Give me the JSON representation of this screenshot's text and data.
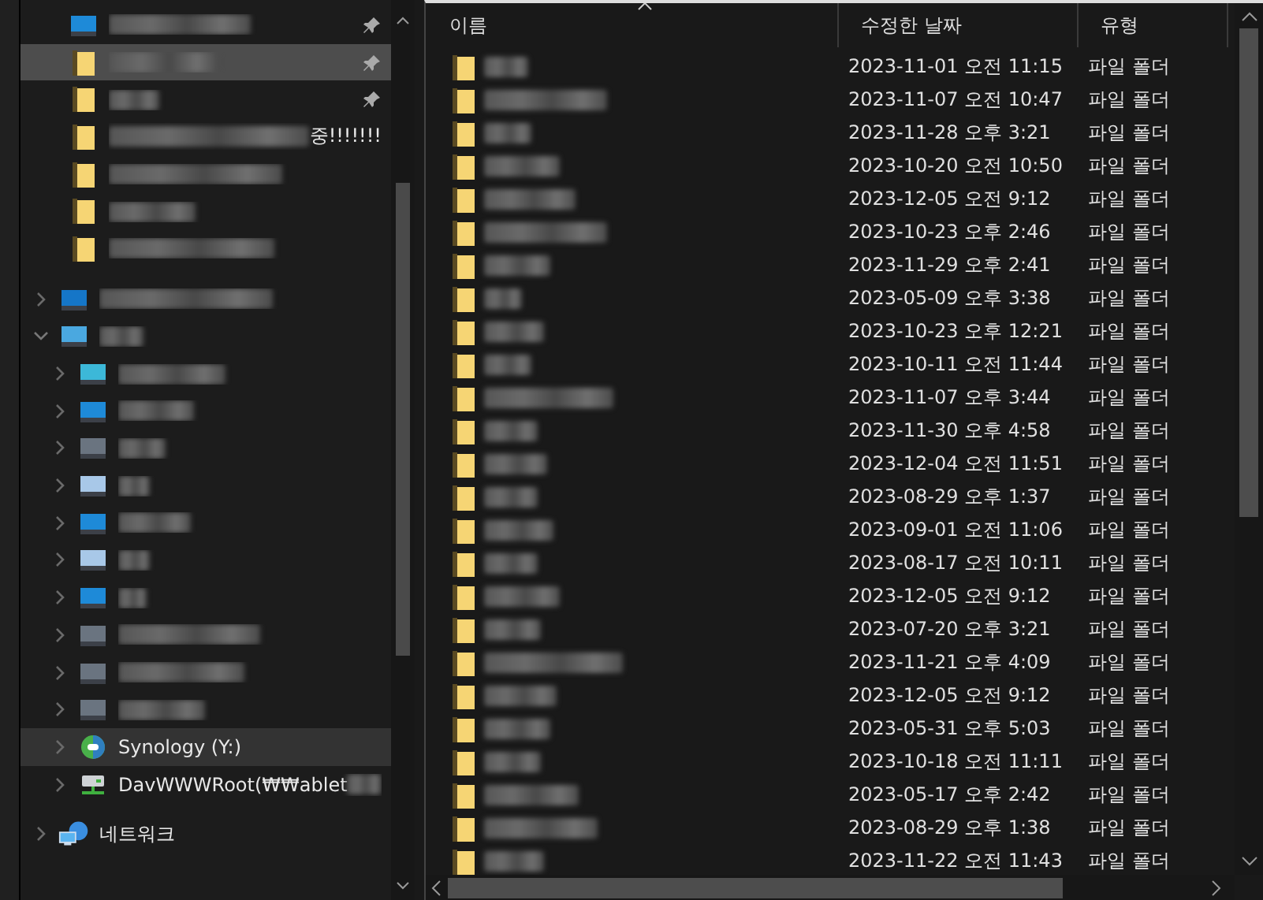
{
  "sidebar": {
    "items": [
      {
        "kind": "blue",
        "blurred": true,
        "pinned": true,
        "selected": false
      },
      {
        "kind": "folder",
        "blurred": true,
        "pinned": true,
        "selected": true
      },
      {
        "kind": "folder",
        "blurred": true,
        "pinned": true,
        "selected": false
      },
      {
        "kind": "folder",
        "blurred": true,
        "label": "중!!!!!!!",
        "pinned": false,
        "selected": false
      },
      {
        "kind": "folder",
        "blurred": true,
        "pinned": false,
        "selected": false
      },
      {
        "kind": "folder",
        "blurred": true,
        "pinned": false,
        "selected": false
      },
      {
        "kind": "folder",
        "blurred": true,
        "pinned": false,
        "selected": false
      },
      {
        "kind": "cloud",
        "blurred": true,
        "expanded": false,
        "selected": false
      },
      {
        "kind": "pc",
        "blurred": true,
        "expanded": true,
        "selected": false,
        "children": [
          {
            "kind": "cyan",
            "blurred": true,
            "expanded": false,
            "selected": false
          },
          {
            "kind": "blue",
            "blurred": true,
            "expanded": false,
            "selected": false
          },
          {
            "kind": "grey",
            "blurred": true,
            "expanded": false,
            "selected": false
          },
          {
            "kind": "light",
            "blurred": true,
            "expanded": false,
            "selected": false
          },
          {
            "kind": "blue",
            "blurred": true,
            "expanded": false,
            "selected": false
          },
          {
            "kind": "light",
            "blurred": true,
            "expanded": false,
            "selected": false
          },
          {
            "kind": "blue",
            "blurred": true,
            "expanded": false,
            "selected": false
          },
          {
            "kind": "grey",
            "blurred": true,
            "expanded": false,
            "selected": false
          },
          {
            "kind": "grey",
            "blurred": true,
            "expanded": false,
            "selected": false
          },
          {
            "kind": "grey",
            "blurred": true,
            "expanded": false,
            "selected": false
          },
          {
            "kind": "nas",
            "blurred": false,
            "label": "Synology (Y:)",
            "expanded": false,
            "selected": true
          },
          {
            "kind": "netdrive",
            "blurred": true,
            "label": "DavWWWRoot(₩₩ablet",
            "expanded": false,
            "selected": false
          }
        ]
      },
      {
        "kind": "network",
        "blurred": false,
        "label": "네트워크",
        "expanded": false,
        "selected": false
      }
    ]
  },
  "table": {
    "columns": [
      "이름",
      "수정한 날짜",
      "유형"
    ],
    "rows": [
      {
        "date": "2023-11-01 오전 11:15",
        "type": "파일 폴더"
      },
      {
        "date": "2023-11-07 오전 10:47",
        "type": "파일 폴더"
      },
      {
        "date": "2023-11-28 오후 3:21",
        "type": "파일 폴더"
      },
      {
        "date": "2023-10-20 오전 10:50",
        "type": "파일 폴더"
      },
      {
        "date": "2023-12-05 오전 9:12",
        "type": "파일 폴더"
      },
      {
        "date": "2023-10-23 오후 2:46",
        "type": "파일 폴더"
      },
      {
        "date": "2023-11-29 오후 2:41",
        "type": "파일 폴더"
      },
      {
        "date": "2023-05-09 오후 3:38",
        "type": "파일 폴더"
      },
      {
        "date": "2023-10-23 오후 12:21",
        "type": "파일 폴더"
      },
      {
        "date": "2023-10-11 오전 11:44",
        "type": "파일 폴더"
      },
      {
        "date": "2023-11-07 오후 3:44",
        "type": "파일 폴더"
      },
      {
        "date": "2023-11-30 오후 4:58",
        "type": "파일 폴더"
      },
      {
        "date": "2023-12-04 오전 11:51",
        "type": "파일 폴더"
      },
      {
        "date": "2023-08-29 오후 1:37",
        "type": "파일 폴더"
      },
      {
        "date": "2023-09-01 오전 11:06",
        "type": "파일 폴더"
      },
      {
        "date": "2023-08-17 오전 10:11",
        "type": "파일 폴더"
      },
      {
        "date": "2023-12-05 오전 9:12",
        "type": "파일 폴더"
      },
      {
        "date": "2023-07-20 오후 3:21",
        "type": "파일 폴더"
      },
      {
        "date": "2023-11-21 오후 4:09",
        "type": "파일 폴더"
      },
      {
        "date": "2023-12-05 오전 9:12",
        "type": "파일 폴더"
      },
      {
        "date": "2023-05-31 오후 5:03",
        "type": "파일 폴더"
      },
      {
        "date": "2023-10-18 오전 11:11",
        "type": "파일 폴더"
      },
      {
        "date": "2023-05-17 오후 2:42",
        "type": "파일 폴더"
      },
      {
        "date": "2023-08-29 오후 1:38",
        "type": "파일 폴더"
      },
      {
        "date": "2023-11-22 오전 11:43",
        "type": "파일 폴더"
      }
    ]
  }
}
